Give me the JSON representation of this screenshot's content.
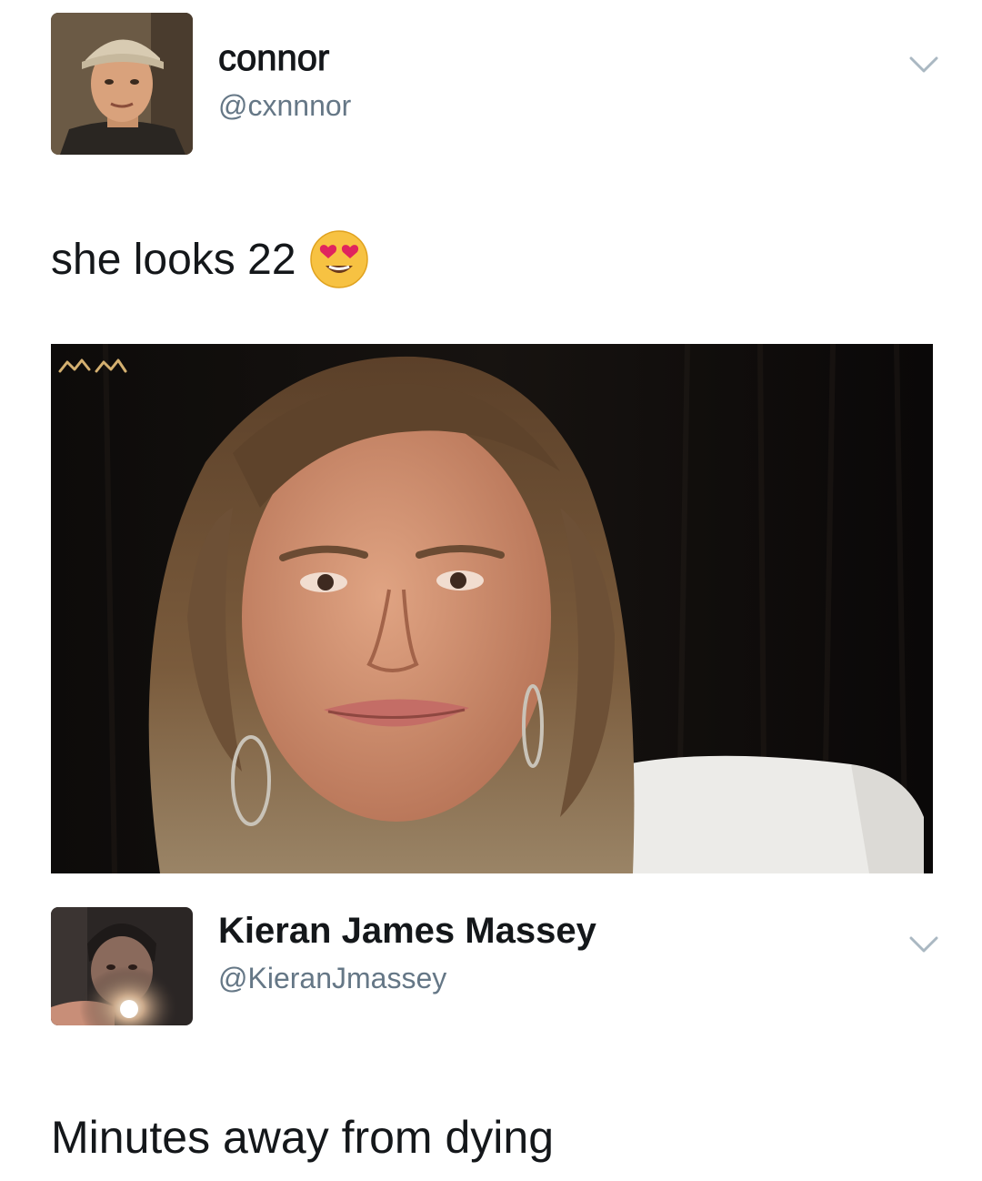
{
  "tweets": [
    {
      "display_name": "connor",
      "handle": "@cxnnnor",
      "text": "she looks 22",
      "emoji": "heart-eyes-emoji",
      "menu_icon": "chevron-down-icon",
      "media": {
        "watermark": "MM",
        "description_icon": "photo"
      }
    },
    {
      "display_name": "Kieran James Massey",
      "handle": "@KieranJmassey",
      "text": "Minutes away from dying",
      "menu_icon": "chevron-down-icon"
    }
  ],
  "colors": {
    "text": "#14171a",
    "handle": "#657786",
    "chevron": "#aab8c2",
    "photo_background": "#0b0908"
  }
}
